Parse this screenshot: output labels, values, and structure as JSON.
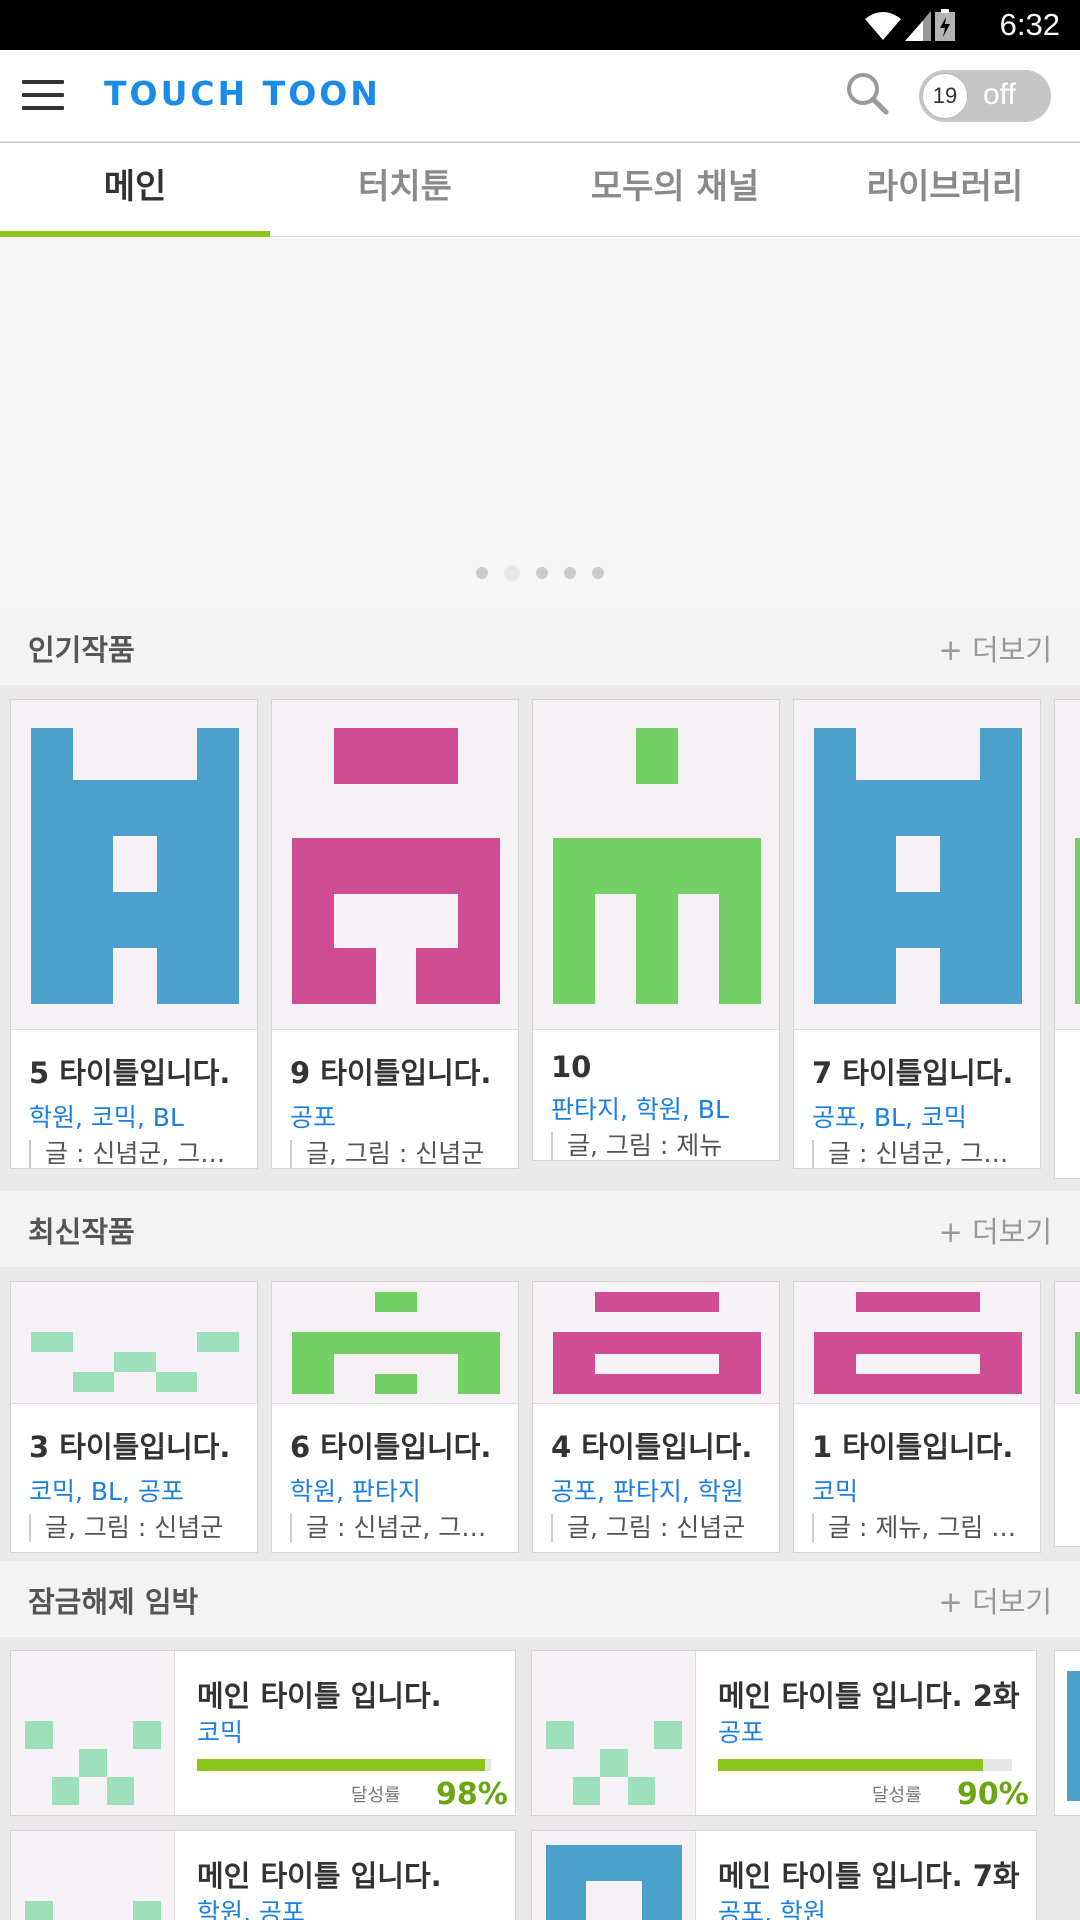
{
  "status_bar": {
    "time": "6:32"
  },
  "app": {
    "logo": "TOUCH TOON",
    "age_toggle_number": "19",
    "age_toggle_label": "off"
  },
  "tabs": [
    {
      "label": "메인"
    },
    {
      "label": "터치툰"
    },
    {
      "label": "모두의 채널"
    },
    {
      "label": "라이브러리"
    }
  ],
  "banner": {
    "page_count": 5,
    "active_index": 1
  },
  "popular": {
    "title": "인기작품",
    "more": "+ 더보기",
    "items": [
      {
        "title": "5 타이틀입니다.",
        "genres": "학원, 코믹, BL",
        "author": "글 : 신념군, 그림 : 제뉴"
      },
      {
        "title": "9 타이틀입니다.",
        "genres": "공포",
        "author": "글, 그림 : 신념군"
      },
      {
        "title": "10",
        "genres": "판타지, 학원, BL",
        "author": "글, 그림 : 제뉴"
      },
      {
        "title": "7 타이틀입니다.",
        "genres": "공포, BL, 코믹",
        "author": "글 : 신념군, 그림 : 제뉴"
      }
    ]
  },
  "recent": {
    "title": "최신작품",
    "more": "+ 더보기",
    "items": [
      {
        "title": "3 타이틀입니다.",
        "genres": "코믹, BL, 공포",
        "author": "글, 그림 : 신념군"
      },
      {
        "title": "6 타이틀입니다.",
        "genres": "학원, 판타지",
        "author": "글 : 신념군, 그림 : 제뉴"
      },
      {
        "title": "4 타이틀입니다.",
        "genres": "공포, 판타지, 학원",
        "author": "글, 그림 : 신념군"
      },
      {
        "title": "1 타이틀입니다.",
        "genres": "코믹",
        "author": "글 : 제뉴, 그림 : 신념군"
      }
    ]
  },
  "unlock": {
    "title": "잠금해제 임박",
    "more": "+ 더보기",
    "rate_label": "달성률",
    "items": [
      {
        "title": "메인 타이틀 입니다.",
        "genres": "코믹",
        "progress": 0.98,
        "percent": "98%"
      },
      {
        "title": "메인 타이틀 입니다. 2화",
        "genres": "공포",
        "progress": 0.9,
        "percent": "90%"
      },
      {
        "title": "메인 타이틀 입니다.",
        "genres": "학원, 공포"
      },
      {
        "title": "메인 타이틀 입니다. 7화",
        "genres": "공포, 학원"
      }
    ]
  },
  "colors": {
    "accent": "#1a8be8",
    "tab_indicator": "#8bc41c",
    "blue_art": "#4ca1cc",
    "pink_art": "#d04d94",
    "green_art": "#72d064",
    "mint_art": "#9fe0bc"
  }
}
